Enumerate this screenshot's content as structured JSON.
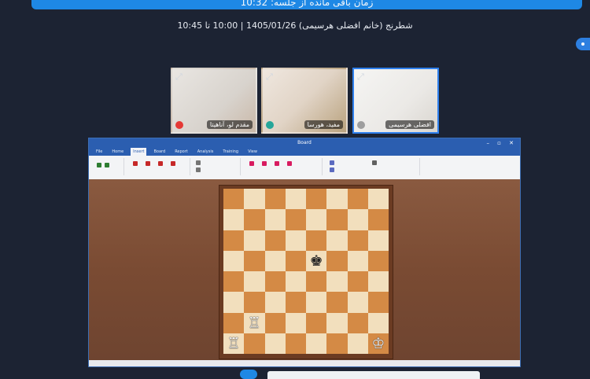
{
  "meeting": {
    "top_banner": "زمان باقی مانده از جلسه: 10:32",
    "session_title": "شطرنج (خانم افضلی هرسیمی) 1405/01/26 | 10:00 تا 10:45"
  },
  "participants": [
    {
      "name": "مقدم لو، آناهیتا",
      "mic_color": "#e53935",
      "active": false
    },
    {
      "name": "مفید، هورسا",
      "mic_color": "#26a69a",
      "active": false
    },
    {
      "name": "افضلی هرسیمی",
      "mic_color": "#9e9e9e",
      "active": true
    }
  ],
  "app": {
    "window_title": "Board",
    "menu": [
      "File",
      "Home",
      "Insert",
      "Board",
      "Report",
      "Analysis",
      "Training",
      "View"
    ],
    "selected_menu": "Insert"
  },
  "board": {
    "pieces": [
      {
        "square": "e5",
        "glyph": "♚",
        "color": "black",
        "piece": "black-king"
      },
      {
        "square": "b2",
        "glyph": "♖",
        "color": "white",
        "piece": "white-rook"
      },
      {
        "square": "a1",
        "glyph": "♖",
        "color": "white",
        "piece": "white-rook"
      },
      {
        "square": "h1",
        "glyph": "♔",
        "color": "white",
        "piece": "white-king"
      }
    ]
  },
  "colors": {
    "accent": "#1e88e5",
    "light_square": "#f2dfbd",
    "dark_square": "#d48a45"
  }
}
